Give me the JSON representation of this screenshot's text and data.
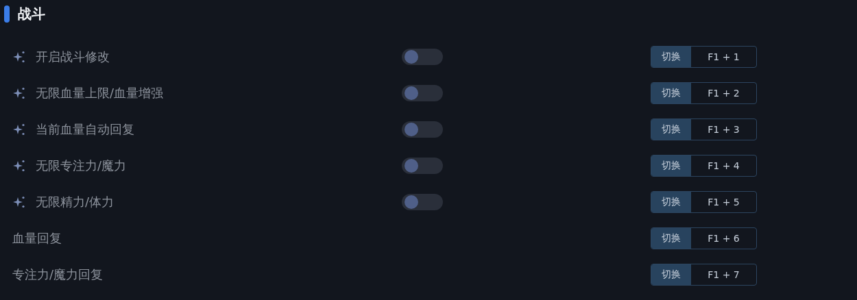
{
  "section": {
    "title": "战斗"
  },
  "rows": [
    {
      "kind": "toggle",
      "label": "开启战斗修改",
      "on": false,
      "hotkey": {
        "action": "切换",
        "keys": "F1 + 1"
      }
    },
    {
      "kind": "toggle",
      "label": "无限血量上限/血量增强",
      "on": false,
      "hotkey": {
        "action": "切换",
        "keys": "F1 + 2"
      }
    },
    {
      "kind": "toggle",
      "label": "当前血量自动回复",
      "on": false,
      "hotkey": {
        "action": "切换",
        "keys": "F1 + 3"
      }
    },
    {
      "kind": "toggle",
      "label": "无限专注力/魔力",
      "on": false,
      "hotkey": {
        "action": "切换",
        "keys": "F1 + 4"
      }
    },
    {
      "kind": "toggle",
      "label": "无限精力/体力",
      "on": false,
      "hotkey": {
        "action": "切换",
        "keys": "F1 + 5"
      }
    },
    {
      "kind": "plain",
      "label": "血量回复",
      "hotkey": {
        "action": "切换",
        "keys": "F1 + 6"
      }
    },
    {
      "kind": "plain",
      "label": "专注力/魔力回复",
      "hotkey": {
        "action": "切换",
        "keys": "F1 + 7"
      }
    }
  ]
}
